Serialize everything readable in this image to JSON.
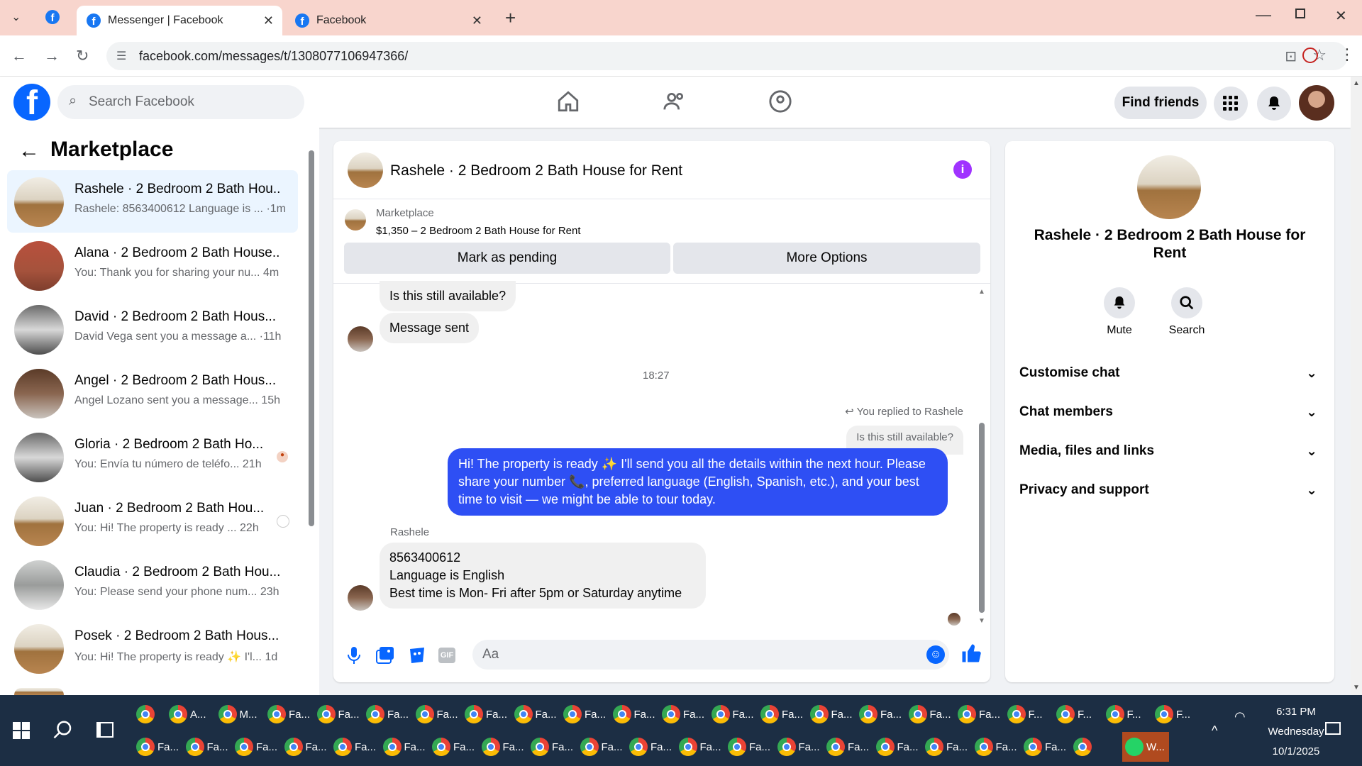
{
  "browser": {
    "tabs": [
      {
        "title": "Messenger | Facebook",
        "active": true
      },
      {
        "title": "Facebook",
        "active": false
      }
    ],
    "url": "facebook.com/messages/t/1308077106947366/"
  },
  "fb_header": {
    "search_placeholder": "Search Facebook",
    "find_friends": "Find friends"
  },
  "left_panel": {
    "title": "Marketplace",
    "conversations": [
      {
        "name": "Rashele · 2 Bedroom 2 Bath Hou...",
        "preview": "Rashele: 8563400612 Language is ...",
        "time": "·1m",
        "selected": true
      },
      {
        "name": "Alana · 2 Bedroom 2 Bath House...",
        "preview": "You: Thank you for sharing your nu...",
        "time": "4m"
      },
      {
        "name": "David · 2 Bedroom 2 Bath Hous...",
        "preview": "David Vega sent you a message a...",
        "time": "·11h"
      },
      {
        "name": "Angel · 2 Bedroom 2 Bath Hous...",
        "preview": "Angel Lozano sent you a message...",
        "time": "15h"
      },
      {
        "name": "Gloria · 2 Bedroom 2 Bath Ho...",
        "preview": "You: Envía tu número de teléfo...",
        "time": "21h"
      },
      {
        "name": "Juan · 2 Bedroom 2 Bath Hou...",
        "preview": "You: Hi! The property is ready ...",
        "time": "22h"
      },
      {
        "name": "Claudia · 2 Bedroom 2 Bath Hou...",
        "preview": "You: Please send your phone num...",
        "time": "23h"
      },
      {
        "name": "Posek · 2 Bedroom 2 Bath Hous...",
        "preview": "You: Hi! The property is ready ✨ I'l...",
        "time": "1d"
      }
    ]
  },
  "chat": {
    "title": "Rashele · 2 Bedroom 2 Bath House for Rent",
    "listing_source": "Marketplace",
    "listing_info": "$1,350 – 2 Bedroom 2 Bath House for Rent",
    "btn_pending": "Mark as pending",
    "btn_more": "More Options",
    "msg_still_available": "Is this still available?",
    "msg_sent": "Message sent",
    "timestamp": "18:27",
    "replied_label": "You replied to Rashele",
    "quoted": "Is this still available?",
    "my_message": "Hi! The property is ready ✨ I'll send you all the details within the next hour. Please share your number 📞, preferred language (English, Spanish, etc.), and your best time to visit — we might be able to tour today.",
    "sender_name": "Rashele",
    "reply_lines": [
      "8563400612",
      "Language is English",
      "Best time is Mon- Fri after 5pm or Saturday anytime"
    ],
    "composer_placeholder": "Aa"
  },
  "info_panel": {
    "title": "Rashele · 2 Bedroom 2 Bath House for Rent",
    "mute": "Mute",
    "search": "Search",
    "sections": [
      "Customise chat",
      "Chat members",
      "Media, files and links",
      "Privacy and support"
    ]
  },
  "taskbar": {
    "row1": [
      "A...",
      "M...",
      "Fa...",
      "Fa...",
      "Fa...",
      "Fa...",
      "Fa...",
      "Fa...",
      "Fa...",
      "Fa...",
      "Fa...",
      "Fa...",
      "Fa...",
      "Fa...",
      "Fa...",
      "Fa...",
      "Fa...",
      "F...",
      "F...",
      "F...",
      "F..."
    ],
    "row2": [
      "Fa...",
      "Fa...",
      "Fa...",
      "Fa...",
      "Fa...",
      "Fa...",
      "Fa...",
      "Fa...",
      "Fa...",
      "Fa...",
      "Fa...",
      "Fa...",
      "Fa...",
      "Fa...",
      "Fa...",
      "Fa...",
      "Fa...",
      "Fa...",
      "Fa...",
      "",
      "W..."
    ],
    "time": "6:31 PM",
    "day": "Wednesday",
    "date": "10/1/2025"
  }
}
